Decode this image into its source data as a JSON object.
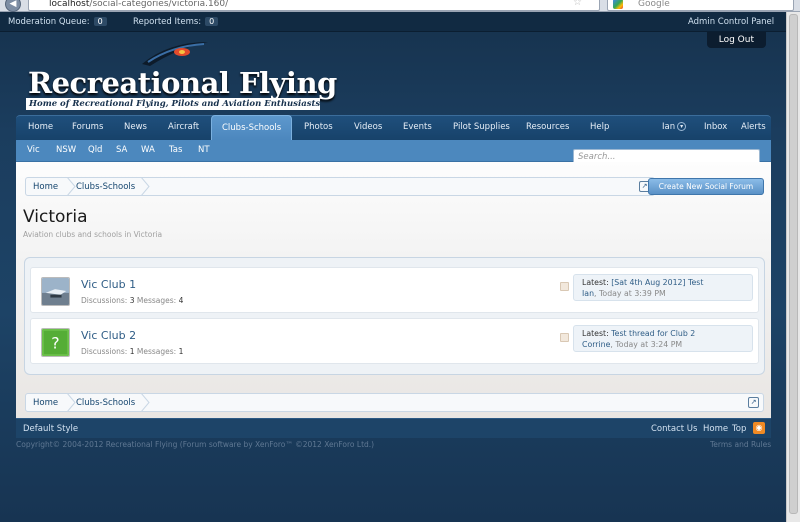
{
  "browser": {
    "url_host": "localhost",
    "url_path": "/social-categories/victoria.160/",
    "search_placeholder": "Google"
  },
  "adminbar": {
    "moderation_label": "Moderation Queue:",
    "moderation_count": "0",
    "reported_label": "Reported Items:",
    "reported_count": "0",
    "admin_link": "Admin Control Panel",
    "logout": "Log Out"
  },
  "logo": {
    "title": "Recreational Flying",
    "tagline": "Home of Recreational Flying, Pilots and Aviation Enthusiasts"
  },
  "nav": {
    "tabs": [
      "Home",
      "Forums",
      "News",
      "Aircraft",
      "Clubs-Schools",
      "Photos",
      "Videos",
      "Events",
      "Pilot Supplies",
      "Resources",
      "Help"
    ],
    "active": "Clubs-Schools",
    "user": "Ian",
    "inbox": "Inbox",
    "alerts": "Alerts"
  },
  "subnav": {
    "items": [
      "Vic",
      "NSW",
      "Qld",
      "SA",
      "WA",
      "Tas",
      "NT"
    ],
    "search_placeholder": "Search..."
  },
  "breadcrumb": [
    "Home",
    "Clubs-Schools"
  ],
  "create_button": "Create New Social Forum",
  "page": {
    "title": "Victoria",
    "description": "Aviation clubs and schools in Victoria"
  },
  "forums": [
    {
      "name": "Vic Club 1",
      "discussions_label": "Discussions:",
      "discussions": "3",
      "messages_label": "Messages:",
      "messages": "4",
      "latest_label": "Latest:",
      "latest_title": "[Sat 4th Aug 2012] Test",
      "latest_user": "Ian",
      "latest_time": "Today at 3:39 PM"
    },
    {
      "name": "Vic Club 2",
      "discussions_label": "Discussions:",
      "discussions": "1",
      "messages_label": "Messages:",
      "messages": "1",
      "latest_label": "Latest:",
      "latest_title": "Test thread for Club 2",
      "latest_user": "Corrine",
      "latest_time": "Today at 3:24 PM"
    }
  ],
  "footer": {
    "style": "Default Style",
    "contact": "Contact Us",
    "home": "Home",
    "top": "Top",
    "copyright": "Copyright© 2004-2012 Recreational Flying (Forum software by XenForo™ ©2012 XenForo Ltd.)",
    "terms": "Terms and Rules"
  },
  "colors": {
    "page_bg": "#1b3d5e",
    "nav_active": "#5d98cd",
    "link": "#2f5d86"
  }
}
